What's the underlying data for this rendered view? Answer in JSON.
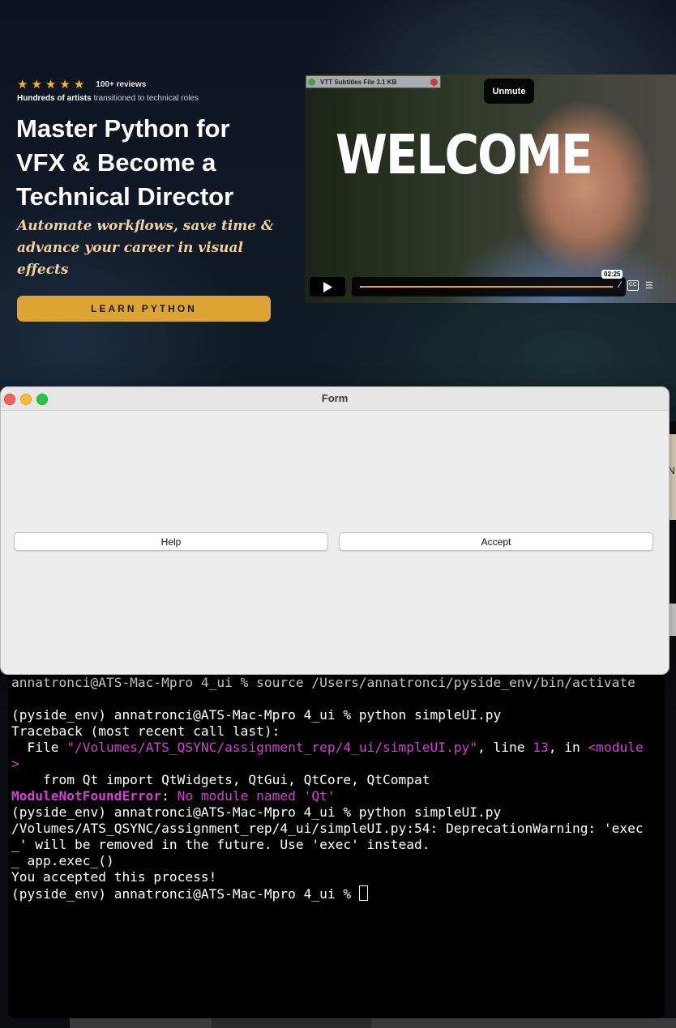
{
  "hero": {
    "stars": [
      "★",
      "★",
      "★",
      "★",
      "★"
    ],
    "reviews": "100+ reviews",
    "social_bold": "Hundreds of artists",
    "social_rest": " transitioned to technical roles",
    "headline": "Master Python for VFX & Become a Technical Director",
    "tagline": "Automate workflows, save time & advance your career in visual effects",
    "cta": "LEARN PYTHON"
  },
  "video": {
    "title_text": "WELCOME",
    "vtt_label": "VTT Subtitles File 3.1 KB",
    "unmute": "Unmute",
    "time": "02:25",
    "cc": "CC"
  },
  "side_strip": {
    "text": "N"
  },
  "form": {
    "title": "Form",
    "help": "Help",
    "accept": "Accept"
  },
  "terminal": {
    "line1": "annatronci@ATS-Mac-Mpro 4_ui % source /Users/annatronci/pyside_env/bin/activate",
    "line2": "(pyside_env) annatronci@ATS-Mac-Mpro 4_ui % python simpleUI.py",
    "line3": "Traceback (most recent call last):",
    "line4_pre": "  File ",
    "line4_path": "\"/Volumes/ATS_QSYNC/assignment_rep/4_ui/simpleUI.py\"",
    "line4_mid": ", line ",
    "line4_num": "13",
    "line4_in": ", in ",
    "line4_mod": "<module",
    "line5": ">",
    "line6": "    from Qt import QtWidgets, QtGui, QtCore, QtCompat",
    "line7_err": "ModuleNotFoundError",
    "line7_colon": ": ",
    "line7_msg": "No module named 'Qt'",
    "line8": "(pyside_env) annatronci@ATS-Mac-Mpro 4_ui % python simpleUI.py",
    "line9": "/Volumes/ATS_QSYNC/assignment_rep/4_ui/simpleUI.py:54: DeprecationWarning: 'exec",
    "line10": "_' will be removed in the future. Use 'exec' instead.",
    "line11": "_ app.exec_()",
    "line12": "You accepted this process!",
    "line13": "(pyside_env) annatronci@ATS-Mac-Mpro 4_ui % "
  },
  "colors": {
    "accent": "#dea431",
    "tagline": "#f2d29a",
    "terminal_magenta": "#d43fd4"
  }
}
